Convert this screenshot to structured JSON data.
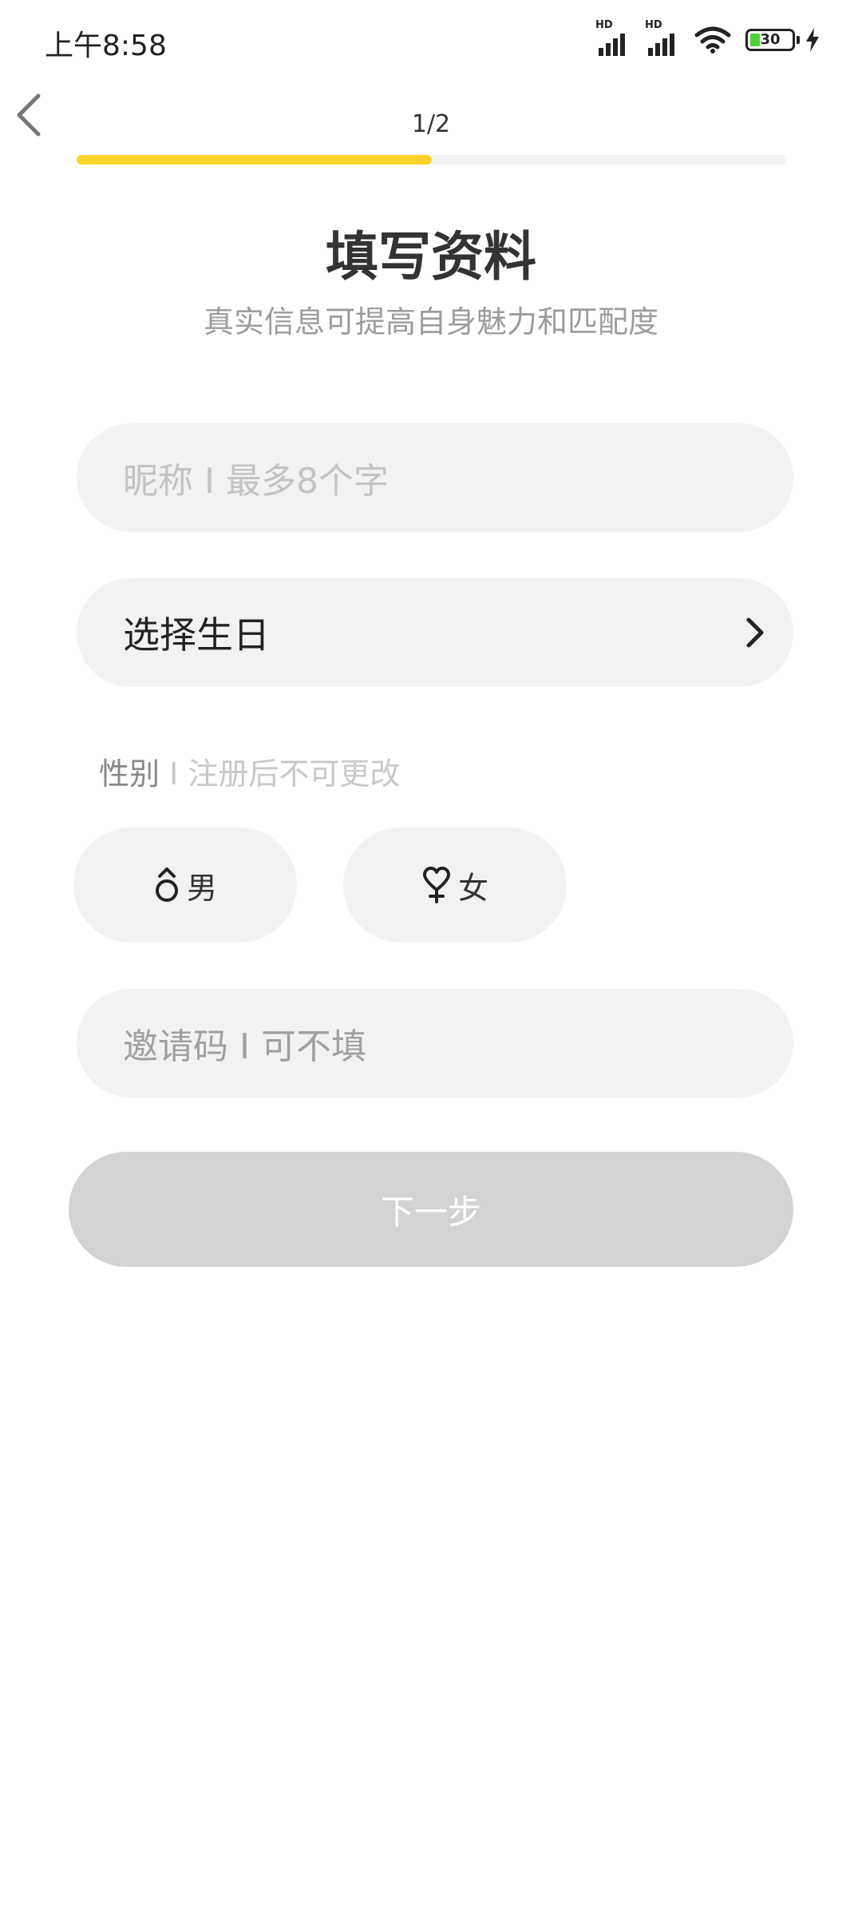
{
  "status_bar": {
    "time": "上午8:58",
    "hd1": "HD",
    "hd2": "HD",
    "battery": "30"
  },
  "header": {
    "step": "1/2",
    "progress": 0.5
  },
  "title": "填写资料",
  "subtitle": "真实信息可提高自身魅力和匹配度",
  "nickname": {
    "placeholder": "昵称 I 最多8个字"
  },
  "birthday": {
    "label": "选择生日"
  },
  "gender": {
    "label": "性别",
    "note": " I 注册后不可更改",
    "male": "男",
    "female": "女"
  },
  "invite": {
    "placeholder": "邀请码 I 可不填"
  },
  "next_button": "下一步",
  "colors": {
    "accent": "#fdd22b",
    "field_bg": "#f2f2f2",
    "button_disabled": "#d3d3d3"
  },
  "icons": [
    "back-arrow-icon",
    "chevron-right-icon",
    "male-icon",
    "female-icon",
    "wifi-icon",
    "charging-icon"
  ]
}
